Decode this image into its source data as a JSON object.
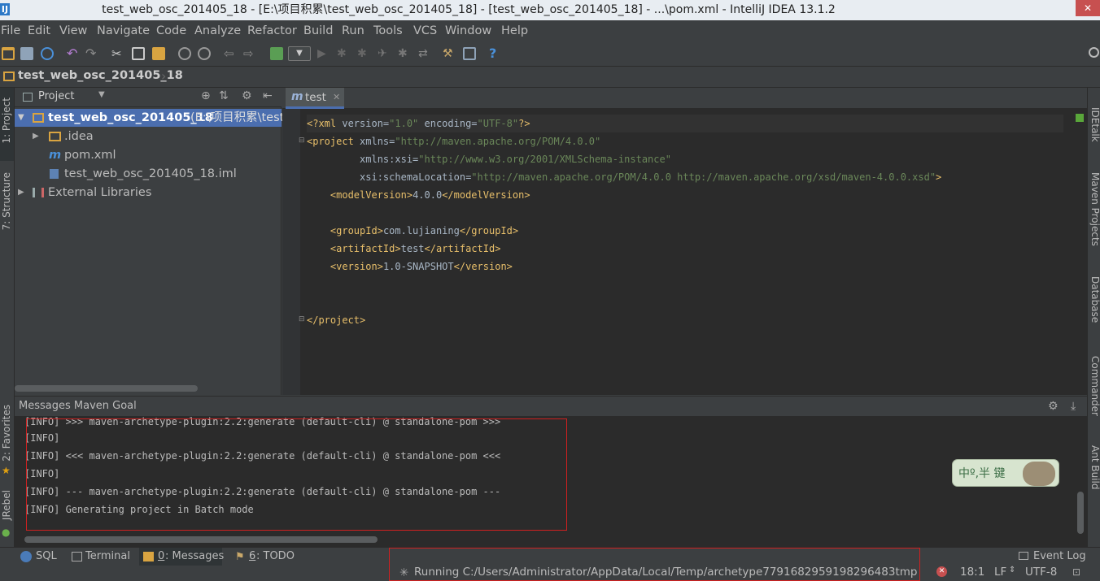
{
  "window": {
    "title": "test_web_osc_201405_18 - [E:\\项目积累\\test_web_osc_201405_18] - [test_web_osc_201405_18] - ...\\pom.xml - IntelliJ IDEA 13.1.2",
    "app_glyph": "IJ"
  },
  "menu": [
    "File",
    "Edit",
    "View",
    "Navigate",
    "Code",
    "Analyze",
    "Refactor",
    "Build",
    "Run",
    "Tools",
    "VCS",
    "Window",
    "Help"
  ],
  "navbar": {
    "breadcrumb": "test_web_osc_201405_18"
  },
  "left_tools": {
    "project": "1: Project",
    "structure": "7: Structure",
    "favorites": "2: Favorites",
    "jrebel": "JRebel"
  },
  "right_tools": {
    "idetalk": "IDEtalk",
    "maven": "Maven Projects",
    "database": "Database",
    "commander": "Commander",
    "ant": "Ant Build"
  },
  "project_panel": {
    "selector": "Project",
    "tree": [
      {
        "name": "test_web_osc_201405_18",
        "suffix": " (E:\\项目积累\\test",
        "level": 0,
        "expanded": true,
        "selected": true
      },
      {
        "name": ".idea",
        "level": 1,
        "expanded": false
      },
      {
        "name": "pom.xml",
        "level": 1
      },
      {
        "name": "test_web_osc_201405_18.iml",
        "level": 1
      },
      {
        "name": "External Libraries",
        "level": 0,
        "expanded": false
      }
    ]
  },
  "editor": {
    "tab": "test",
    "tab_glyph": "m",
    "lines": [
      "<?xml version=\"1.0\" encoding=\"UTF-8\"?>",
      "<project xmlns=\"http://maven.apache.org/POM/4.0.0\"",
      "         xmlns:xsi=\"http://www.w3.org/2001/XMLSchema-instance\"",
      "         xsi:schemaLocation=\"http://maven.apache.org/POM/4.0.0 http://maven.apache.org/xsd/maven-4.0.0.xsd\">",
      "    <modelVersion>4.0.0</modelVersion>",
      "",
      "    <groupId>com.lujianing</groupId>",
      "    <artifactId>test</artifactId>",
      "    <version>1.0-SNAPSHOT</version>",
      "",
      "",
      "</project>"
    ]
  },
  "messages": {
    "title": "Messages Maven Goal",
    "lines": [
      "[INFO] >>> maven-archetype-plugin:2.2:generate (default-cli) @ standalone-pom >>>",
      "[INFO]",
      "[INFO] <<< maven-archetype-plugin:2.2:generate (default-cli) @ standalone-pom <<<",
      "[INFO]",
      "[INFO] --- maven-archetype-plugin:2.2:generate (default-cli) @ standalone-pom ---",
      "[INFO] Generating project in Batch mode"
    ]
  },
  "bottom_tools": [
    {
      "key": "sql",
      "label": "SQL"
    },
    {
      "key": "terminal",
      "label": "Terminal"
    },
    {
      "key": "messages",
      "num": "0",
      "label": ": Messages",
      "active": true
    },
    {
      "key": "todo",
      "num": "6",
      "label": ": TODO"
    }
  ],
  "event_log": "Event Log",
  "status": {
    "running": "Running C:/Users/Administrator/AppData/Local/Temp/archetype7791682959198296483tmp",
    "position": "18:1",
    "line_sep": "LF",
    "encoding": "UTF-8"
  },
  "ime": {
    "label": "中º,半 键"
  },
  "colors": {
    "accent": "#4b6eaf",
    "error_box": "#d02020",
    "tag": "#e8bf6a",
    "string": "#6a8759"
  }
}
